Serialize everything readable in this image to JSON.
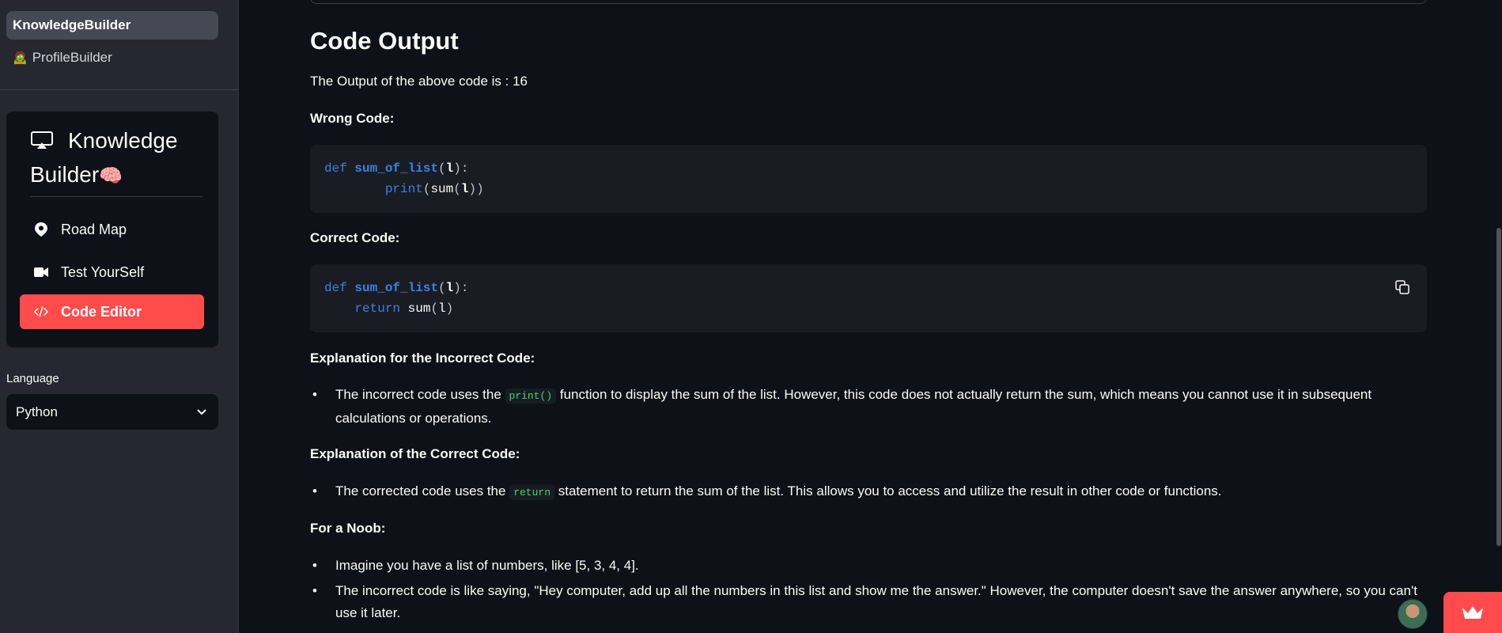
{
  "sidebar": {
    "nav": [
      {
        "label": "KnowledgeBuilder",
        "emoji": ""
      },
      {
        "label": "ProfileBuilder",
        "emoji": "🧟"
      }
    ],
    "menu": {
      "title_line1": "Knowledge",
      "title_line2": "Builder",
      "title_emoji": "🧠",
      "items": [
        {
          "label": "Road Map",
          "icon": "map-pin-icon"
        },
        {
          "label": "Test YourSelf",
          "icon": "video-camera-icon"
        },
        {
          "label": "Code Editor",
          "icon": "code-slash-icon"
        }
      ]
    },
    "language_label": "Language",
    "language_value": "Python"
  },
  "main": {
    "heading": "Code Output",
    "output_text": "The Output of the above code is : 16",
    "wrong_label": "Wrong Code:",
    "wrong_code": {
      "kw_def": "def",
      "fn_name": "sum_of_list",
      "param": "l",
      "body_fn": "print",
      "body_inner": "sum",
      "body_arg": "l"
    },
    "correct_label": "Correct Code:",
    "correct_code": {
      "kw_def": "def",
      "fn_name": "sum_of_list",
      "param": "l",
      "kw_return": "return",
      "body_inner": "sum",
      "body_arg": "l"
    },
    "incorrect_expl_label": "Explanation for the Incorrect Code:",
    "incorrect_expl": {
      "before": "The incorrect code uses the",
      "code": "print()",
      "after": "function to display the sum of the list. However, this code does not actually return the sum, which means you cannot use it in subsequent calculations or operations."
    },
    "correct_expl_label": "Explanation of the Correct Code:",
    "correct_expl": {
      "before": "The corrected code uses the",
      "code": "return",
      "after": "statement to return the sum of the list. This allows you to access and utilize the result in other code or functions."
    },
    "noob_label": "For a Noob:",
    "noob_points": [
      "Imagine you have a list of numbers, like [5, 3, 4, 4].",
      "The incorrect code is like saying, \"Hey computer, add up all the numbers in this list and show me the answer.\" However, the computer doesn't save the answer anywhere, so you can't use it later."
    ]
  },
  "colors": {
    "accent": "#ff4b4b",
    "background": "#0e1117",
    "sidebar": "#262730",
    "code_bg": "#1a1c24",
    "keyword": "#3b82e0",
    "inline_code": "#3dd56d"
  }
}
